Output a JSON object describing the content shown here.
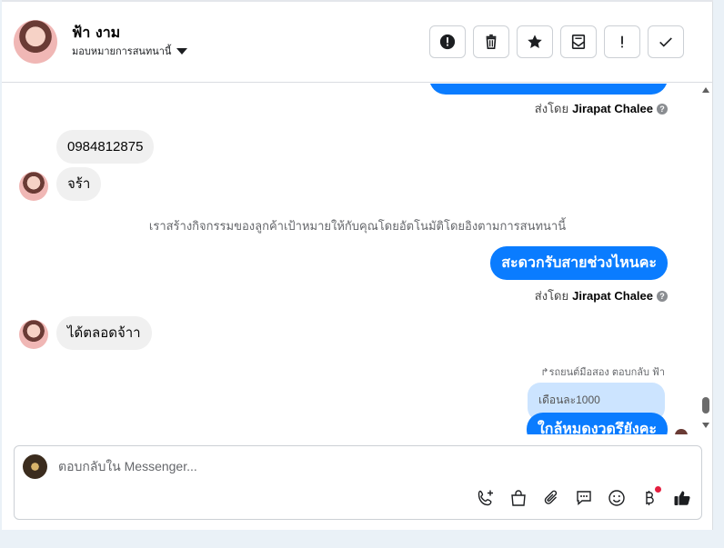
{
  "header": {
    "contact_name": "ฟ้า งาม",
    "subtitle": "มอบหมายการสนทนานี้",
    "actions": [
      {
        "name": "report",
        "icon": "exclamation-circle-icon"
      },
      {
        "name": "delete",
        "icon": "trash-icon"
      },
      {
        "name": "star",
        "icon": "star-icon"
      },
      {
        "name": "mark-unread",
        "icon": "envelope-icon"
      },
      {
        "name": "spam",
        "icon": "exclamation-icon"
      },
      {
        "name": "done",
        "icon": "check-icon"
      }
    ]
  },
  "thread": {
    "sent_by_prefix": "ส่งโดย",
    "agent_name": "Jirapat Chalee",
    "in_msg_1": "0984812875",
    "in_msg_2": "จร้า",
    "system_msg": "เราสร้างกิจกรรมของลูกค้าเป้าหมายให้กับคุณโดยอัตโนมัติโดยอิงตามการสนทนานี้",
    "out_msg_1": "สะดวกรับสายช่วงไหนคะ",
    "in_msg_3": "ได้ตลอดจ้าา",
    "reply_header": "↱รถยนต์มือสอง ตอบกลับ ฟ้า",
    "quoted_text": "เดือนละ1000",
    "out_msg_2": "ใกล้หมดงวดรึยังคะ"
  },
  "composer": {
    "placeholder": "ตอบกลับใน Messenger...",
    "tools": [
      "phone-add-icon",
      "shopping-bag-icon",
      "paperclip-icon",
      "chat-icon",
      "emoji-icon",
      "baht-icon",
      "thumbs-up-icon"
    ]
  },
  "colors": {
    "outgoing": "#0a7cff",
    "incoming": "#f0f0f0",
    "quoted": "#cce4ff"
  }
}
